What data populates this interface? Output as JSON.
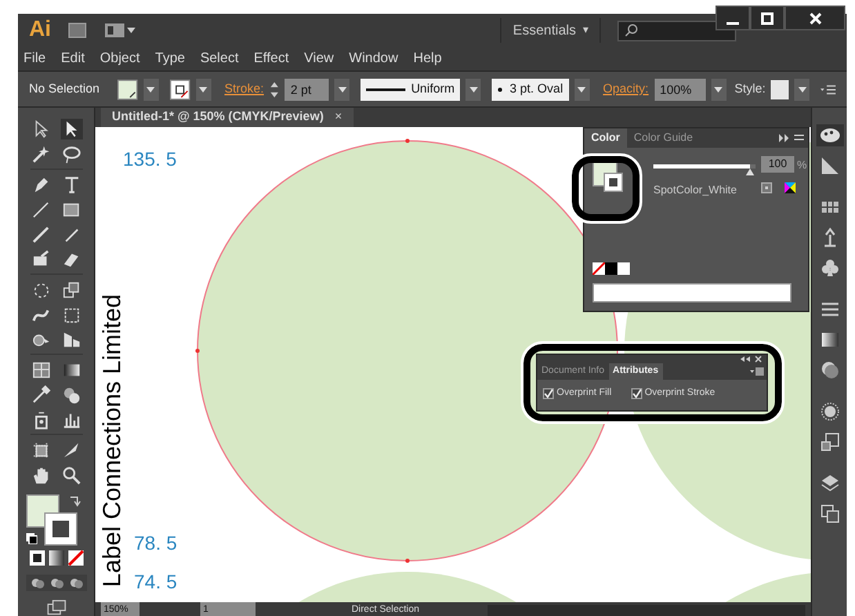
{
  "app": {
    "logo": "Ai",
    "workspace": "Essentials",
    "workspace_caret": "▾"
  },
  "menu": [
    "File",
    "Edit",
    "Object",
    "Type",
    "Select",
    "Effect",
    "View",
    "Window",
    "Help"
  ],
  "control_bar": {
    "selection": "No Selection",
    "stroke_label": "Stroke:",
    "stroke_weight": "2 pt",
    "profile": "Uniform",
    "brush": "3 pt. Oval",
    "opacity_label": "Opacity:",
    "opacity": "100%",
    "style_label": "Style:"
  },
  "document_tab": {
    "title": "Untitled-1* @ 150% (CMYK/Preview)",
    "close": "×"
  },
  "canvas": {
    "labels": [
      "135. 5",
      "78. 5",
      "74. 5"
    ],
    "vertical_text": "Label Connections Limited"
  },
  "color_panel": {
    "tabs": [
      {
        "label": "Color",
        "selected": true
      },
      {
        "label": "Color Guide",
        "selected": false
      }
    ],
    "tint": {
      "level": 0.95
    },
    "tint_value": "100",
    "percent": "%",
    "swatch_name": "SpotColor_White"
  },
  "attributes_panel": {
    "tabs": [
      {
        "label": "Document Info",
        "selected": false
      },
      {
        "label": "Attributes",
        "selected": true
      }
    ],
    "options": [
      {
        "label": "Overprint Fill",
        "checked": true
      },
      {
        "label": "Overprint Stroke",
        "checked": true
      }
    ]
  },
  "status_bar": {
    "zoom": "150%",
    "page": "1",
    "tool": "Direct Selection"
  }
}
